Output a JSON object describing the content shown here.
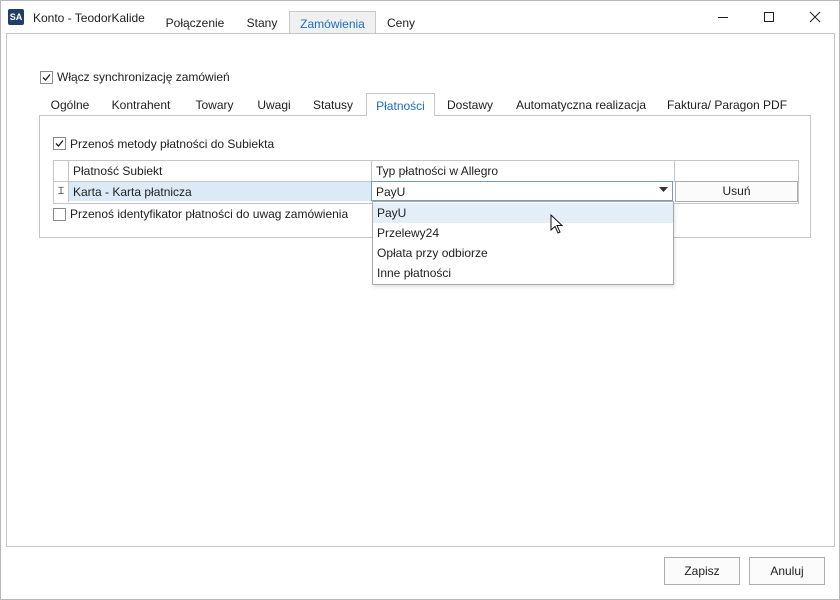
{
  "window": {
    "app_icon_text": "SA",
    "title": "Konto - TeodorKalide",
    "tabs": [
      {
        "label": "Połączenie"
      },
      {
        "label": "Stany"
      },
      {
        "label": "Zamówienia"
      },
      {
        "label": "Ceny"
      }
    ],
    "active_tab": "Zamówienia"
  },
  "sync": {
    "enable_label": "Włącz synchronizację zamówień",
    "enable_checked": true
  },
  "inner_tabs": [
    {
      "label": "Ogólne"
    },
    {
      "label": "Kontrahent"
    },
    {
      "label": "Towary"
    },
    {
      "label": "Uwagi"
    },
    {
      "label": "Statusy"
    },
    {
      "label": "Płatności"
    },
    {
      "label": "Dostawy"
    },
    {
      "label": "Automatyczna realizacja"
    },
    {
      "label": "Faktura/ Paragon PDF"
    }
  ],
  "active_inner_tab": "Płatności",
  "payments": {
    "transfer_methods_label": "Przenoś metody płatności do Subiekta",
    "transfer_methods_checked": true,
    "grid": {
      "columns": [
        "Płatność Subiekt",
        "Typ płatności w Allegro"
      ],
      "rows": [
        {
          "subiekt": "Karta - Karta płatnicza",
          "allegro": "PayU",
          "action": "Usuń"
        }
      ]
    },
    "transfer_id_label": "Przenoś identyfikator płatności do uwag zamówienia",
    "transfer_id_checked": false,
    "dropdown_options": [
      {
        "label": "PayU"
      },
      {
        "label": "Przelewy24"
      },
      {
        "label": "Opłata przy odbiorze"
      },
      {
        "label": "Inne płatności"
      }
    ],
    "dropdown_selected": "PayU"
  },
  "footer": {
    "save_label": "Zapisz",
    "cancel_label": "Anuluj"
  },
  "colors": {
    "accent": "#1a6fbf",
    "row_highlight": "#dce9f7",
    "app_icon_bg": "#1f3f66"
  }
}
